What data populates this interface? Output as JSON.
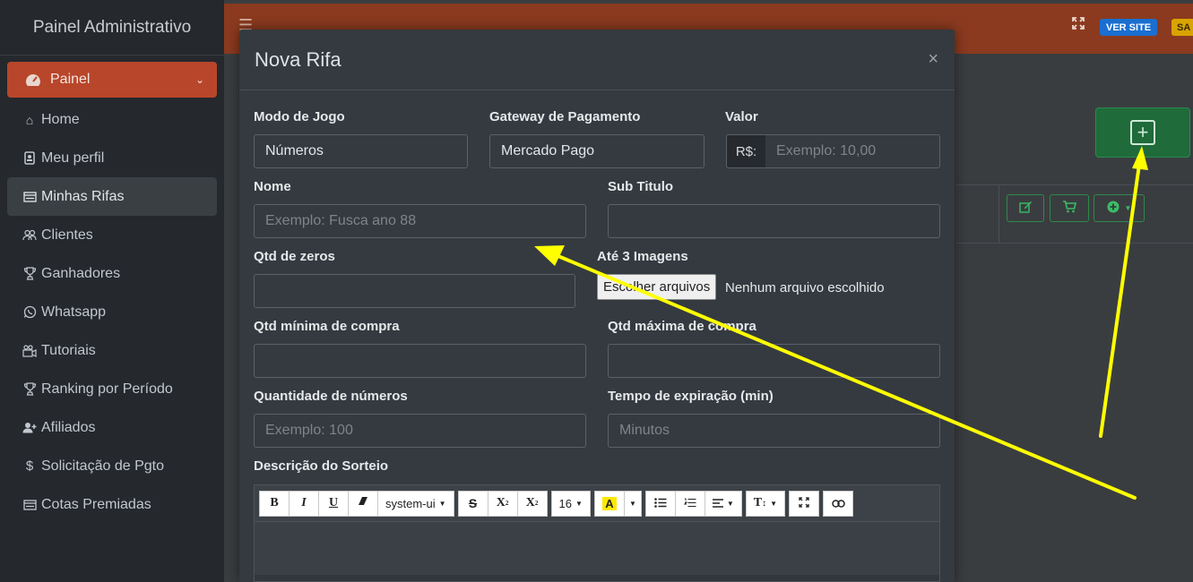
{
  "sidebar": {
    "brand": "Painel Administrativo",
    "items": [
      {
        "label": "Painel",
        "icon": "tachometer-icon"
      },
      {
        "label": "Home",
        "icon": "home-icon"
      },
      {
        "label": "Meu perfil",
        "icon": "id-badge-icon"
      },
      {
        "label": "Minhas Rifas",
        "icon": "list-icon"
      },
      {
        "label": "Clientes",
        "icon": "users-icon"
      },
      {
        "label": "Ganhadores",
        "icon": "trophy-icon"
      },
      {
        "label": "Whatsapp",
        "icon": "whatsapp-icon"
      },
      {
        "label": "Tutoriais",
        "icon": "video-icon"
      },
      {
        "label": "Ranking por Período",
        "icon": "trophy-icon"
      },
      {
        "label": "Afiliados",
        "icon": "user-plus-icon"
      },
      {
        "label": "Solicitação de Pgto",
        "icon": "dollar-icon"
      },
      {
        "label": "Cotas Premiadas",
        "icon": "list-icon"
      }
    ]
  },
  "header": {
    "ver_site": "VER SITE",
    "sa": "SA"
  },
  "modal": {
    "title": "Nova Rifa",
    "close": "×",
    "modo_label": "Modo de Jogo",
    "modo_value": "Números",
    "gateway_label": "Gateway de Pagamento",
    "gateway_value": "Mercado Pago",
    "valor_label": "Valor",
    "valor_prefix": "R$:",
    "valor_placeholder": "Exemplo: 10,00",
    "nome_label": "Nome",
    "nome_placeholder": "Exemplo: Fusca ano 88",
    "subtitulo_label": "Sub Titulo",
    "zeros_label": "Qtd de zeros",
    "imagens_label": "Até 3 Imagens",
    "file_button": "Escolher arquivos",
    "file_status": "Nenhum arquivo escolhido",
    "min_label": "Qtd mínima de compra",
    "max_label": "Qtd máxima de compra",
    "quantidade_label": "Quantidade de números",
    "quantidade_placeholder": "Exemplo: 100",
    "tempo_label": "Tempo de expiração (min)",
    "tempo_placeholder": "Minutos",
    "descricao_label": "Descrição do Sorteio"
  },
  "editor": {
    "bold": "B",
    "italic": "I",
    "underline": "U",
    "font": "system-ui",
    "strike": "S",
    "superscript": "X",
    "subscript": "X",
    "size": "16",
    "highlight": "A",
    "style": "T"
  },
  "colors": {
    "accent": "#b8462a",
    "header": "#8b3a1f",
    "success": "#1f6b3a",
    "annotation_arrow": "#ffff00"
  }
}
